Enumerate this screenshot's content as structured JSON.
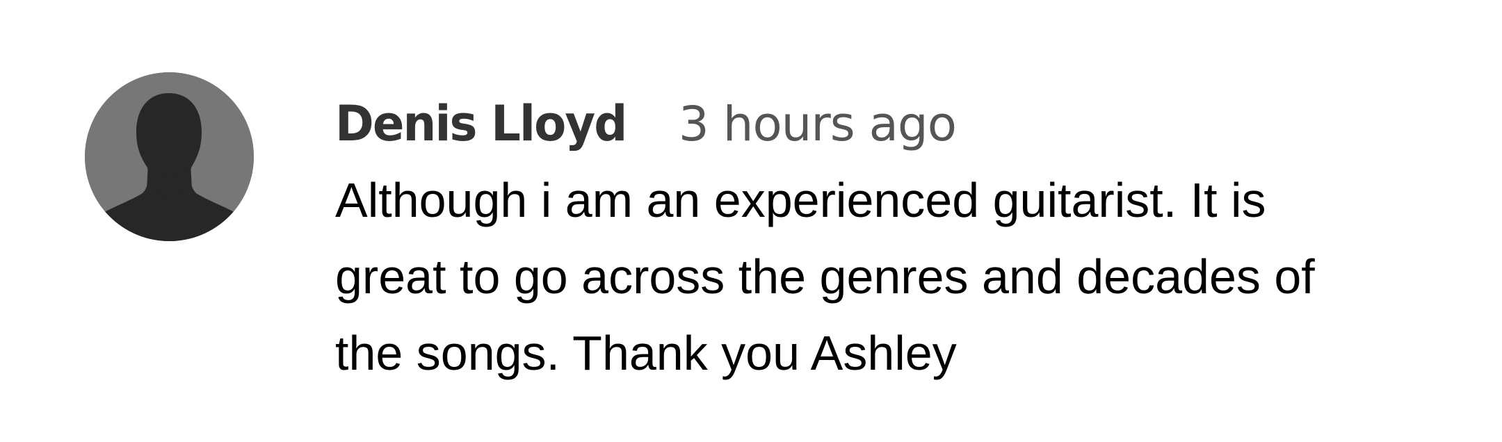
{
  "comment": {
    "avatar_icon": "default-user-silhouette-icon",
    "author": "Denis Lloyd",
    "timestamp": "3 hours ago",
    "text": "Although i am an experienced guitarist. It is\ngreat to go across the genres and decades of\nthe songs. Thank you Ashley"
  },
  "colors": {
    "avatar_background": "#777777",
    "avatar_silhouette": "#272727",
    "author": "#333333",
    "timestamp": "#555555",
    "comment_text": "#000000"
  }
}
